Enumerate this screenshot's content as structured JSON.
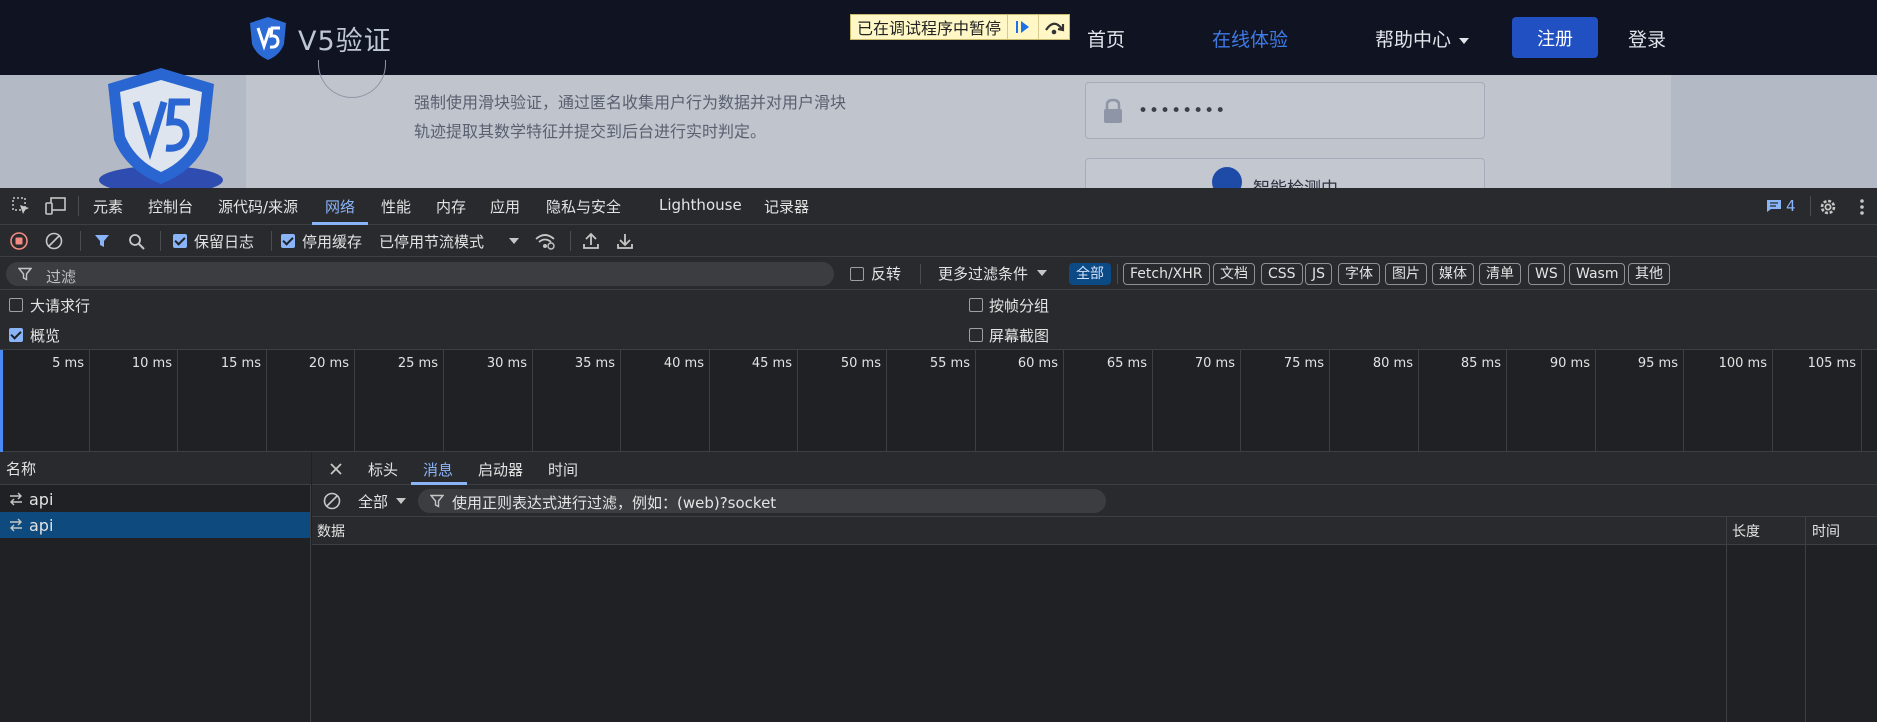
{
  "site": {
    "logo_text": "V5验证",
    "paused_banner": "已在调试程序中暂停",
    "nav": {
      "home": "首页",
      "online": "在线体验",
      "help": "帮助中心",
      "register": "注册",
      "login": "登录"
    },
    "description": "强制使用滑块验证，通过匿名收集用户行为数据并对用户滑块轨迹提取其数学特征并提交到后台进行实时判定。",
    "password_mask": "••••••••",
    "detecting": "智能检测中",
    "colors": {
      "nav_bg": "#0f1322",
      "accent": "#3f7be6",
      "register_bg": "#2150c2"
    }
  },
  "devtools": {
    "tabs": [
      "元素",
      "控制台",
      "源代码/来源",
      "网络",
      "性能",
      "内存",
      "应用",
      "隐私与安全",
      "Lighthouse",
      "记录器"
    ],
    "active_tab": "网络",
    "message_count": "4",
    "toolbar": {
      "preserve_log": "保留日志",
      "disable_cache": "停用缓存",
      "throttling": "已停用节流模式"
    },
    "filter": {
      "placeholder": "过滤",
      "invert": "反转",
      "more_filters": "更多过滤条件",
      "types": [
        "全部",
        "Fetch/XHR",
        "文档",
        "CSS",
        "JS",
        "字体",
        "图片",
        "媒体",
        "清单",
        "WS",
        "Wasm",
        "其他"
      ],
      "active_type": "全部"
    },
    "options": {
      "big_rows": "大请求行",
      "overview": "概览",
      "group_by_frame": "按帧分组",
      "screenshots": "屏幕截图"
    },
    "timeline_ticks": [
      "5 ms",
      "10 ms",
      "15 ms",
      "20 ms",
      "25 ms",
      "30 ms",
      "35 ms",
      "40 ms",
      "45 ms",
      "50 ms",
      "55 ms",
      "60 ms",
      "65 ms",
      "70 ms",
      "75 ms",
      "80 ms",
      "85 ms",
      "90 ms",
      "95 ms",
      "100 ms",
      "105 ms"
    ],
    "requests": {
      "header": "名称",
      "items": [
        "api",
        "api"
      ]
    },
    "detail": {
      "tabs": [
        "标头",
        "消息",
        "启动器",
        "时间"
      ],
      "active_tab": "消息",
      "message_filter_scope": "全部",
      "message_filter_placeholder": "使用正则表达式进行过滤，例如：(web)?socket",
      "columns": [
        "数据",
        "长度",
        "时间"
      ]
    }
  }
}
